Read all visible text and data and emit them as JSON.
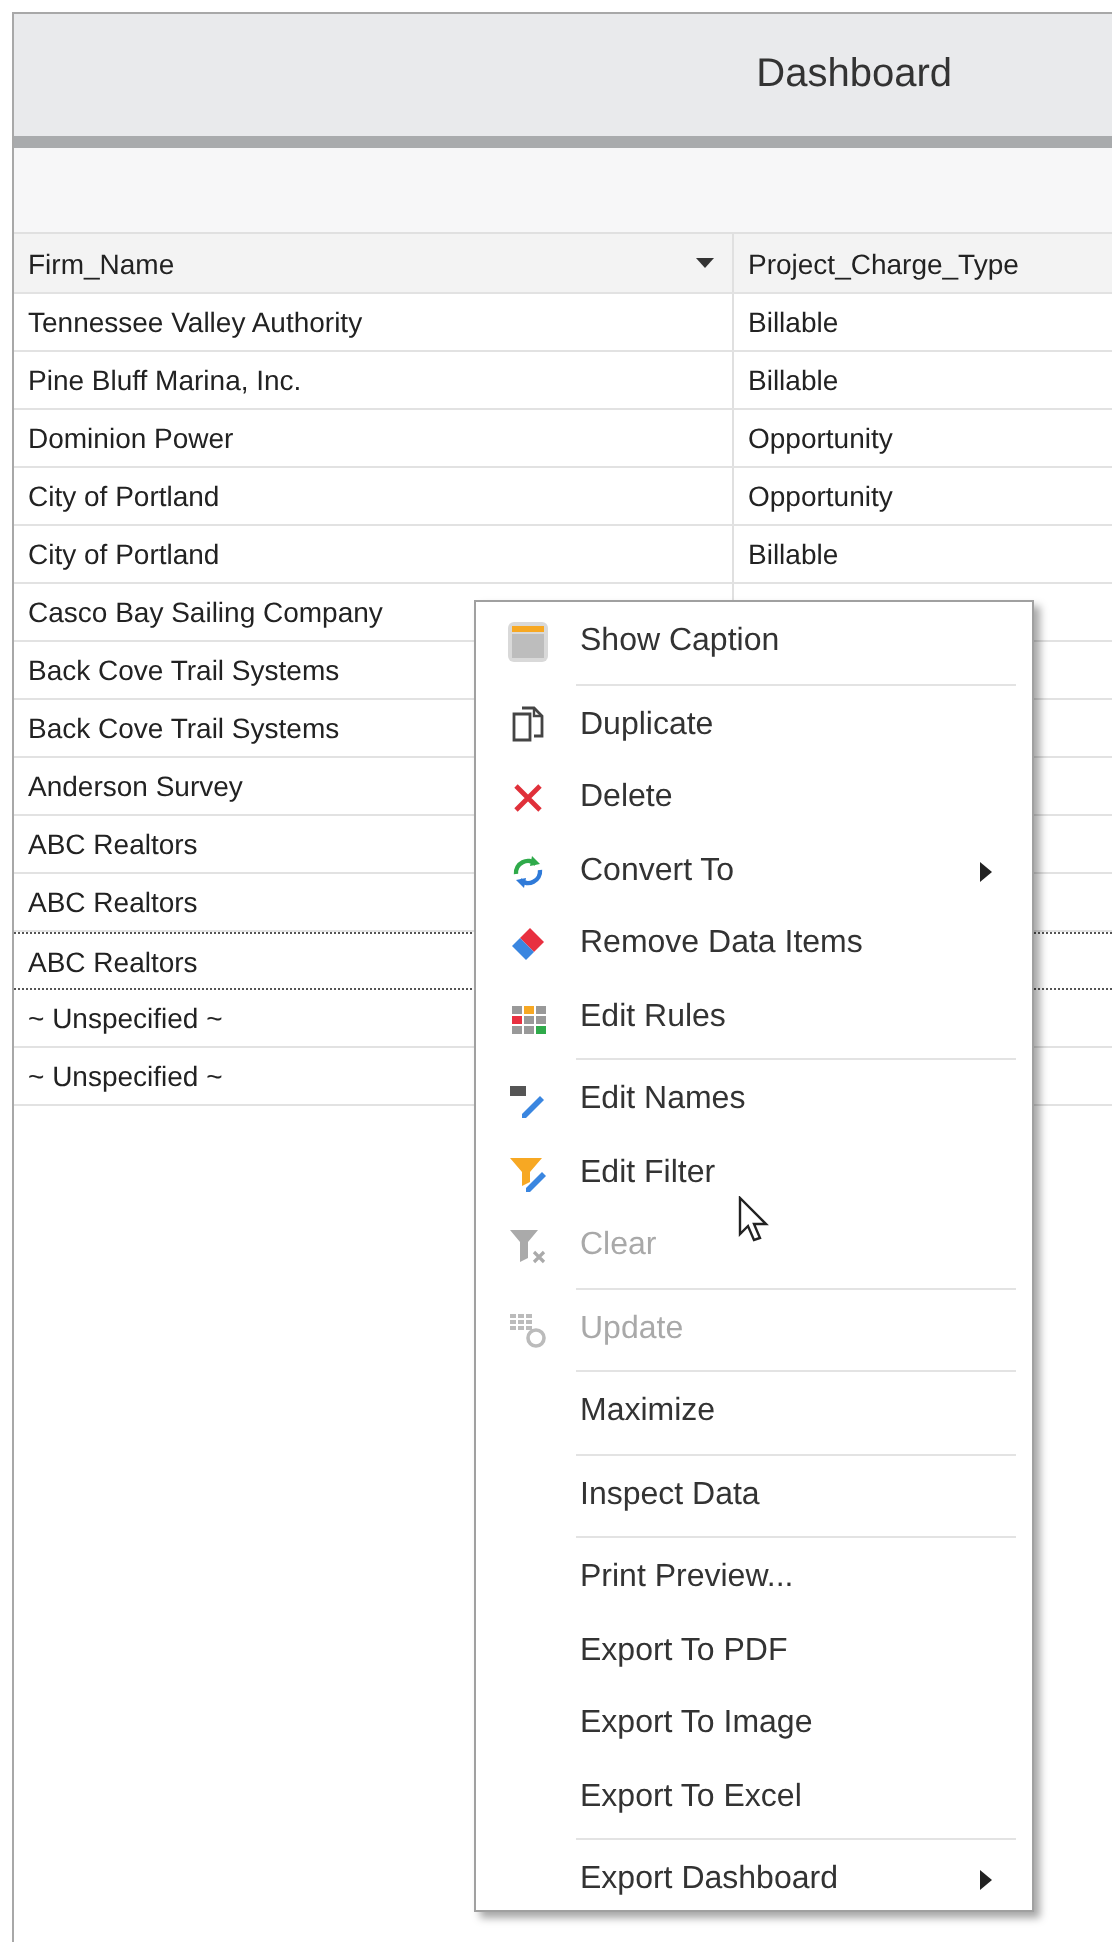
{
  "window": {
    "title": "Dashboard"
  },
  "table": {
    "columns": [
      {
        "label": "Firm_Name",
        "dropdown": true
      },
      {
        "label": "Project_Charge_Type",
        "dropdown": false
      }
    ],
    "rows": [
      {
        "cells": [
          "Tennessee Valley Authority",
          "Billable"
        ],
        "focused": false
      },
      {
        "cells": [
          "Pine Bluff Marina, Inc.",
          "Billable"
        ],
        "focused": false
      },
      {
        "cells": [
          "Dominion Power",
          "Opportunity"
        ],
        "focused": false
      },
      {
        "cells": [
          "City of Portland",
          "Opportunity"
        ],
        "focused": false
      },
      {
        "cells": [
          "City of Portland",
          "Billable"
        ],
        "focused": false
      },
      {
        "cells": [
          "Casco Bay Sailing Company"
        ],
        "focused": false
      },
      {
        "cells": [
          "Back Cove Trail Systems"
        ],
        "focused": false
      },
      {
        "cells": [
          "Back Cove Trail Systems"
        ],
        "focused": false
      },
      {
        "cells": [
          "Anderson Survey"
        ],
        "focused": false
      },
      {
        "cells": [
          "ABC Realtors"
        ],
        "focused": false
      },
      {
        "cells": [
          "ABC Realtors"
        ],
        "focused": false
      },
      {
        "cells": [
          "ABC Realtors"
        ],
        "focused": true
      },
      {
        "cells": [
          "~ Unspecified ~"
        ],
        "focused": false
      },
      {
        "cells": [
          "~ Unspecified ~"
        ],
        "focused": false
      }
    ]
  },
  "context_menu": {
    "items": [
      {
        "label": "Show Caption",
        "disabled": false,
        "submenu": false,
        "separator_after": true
      },
      {
        "label": "Duplicate",
        "disabled": false,
        "submenu": false,
        "separator_after": false
      },
      {
        "label": "Delete",
        "disabled": false,
        "submenu": false,
        "separator_after": false
      },
      {
        "label": "Convert To",
        "disabled": false,
        "submenu": true,
        "separator_after": false
      },
      {
        "label": "Remove Data Items",
        "disabled": false,
        "submenu": false,
        "separator_after": false
      },
      {
        "label": "Edit Rules",
        "disabled": false,
        "submenu": false,
        "separator_after": true
      },
      {
        "label": "Edit Names",
        "disabled": false,
        "submenu": false,
        "separator_after": false
      },
      {
        "label": "Edit Filter",
        "disabled": false,
        "submenu": false,
        "separator_after": false
      },
      {
        "label": "Clear",
        "disabled": true,
        "submenu": false,
        "separator_after": true
      },
      {
        "label": "Update",
        "disabled": true,
        "submenu": false,
        "separator_after": true
      },
      {
        "label": "Maximize",
        "disabled": false,
        "submenu": false,
        "separator_after": true
      },
      {
        "label": "Inspect Data",
        "disabled": false,
        "submenu": false,
        "separator_after": true
      },
      {
        "label": "Print Preview...",
        "disabled": false,
        "submenu": false,
        "separator_after": false
      },
      {
        "label": "Export To PDF",
        "disabled": false,
        "submenu": false,
        "separator_after": false
      },
      {
        "label": "Export To Image",
        "disabled": false,
        "submenu": false,
        "separator_after": false
      },
      {
        "label": "Export To Excel",
        "disabled": false,
        "submenu": false,
        "separator_after": true
      },
      {
        "label": "Export Dashboard",
        "disabled": false,
        "submenu": true,
        "separator_after": false
      }
    ]
  }
}
